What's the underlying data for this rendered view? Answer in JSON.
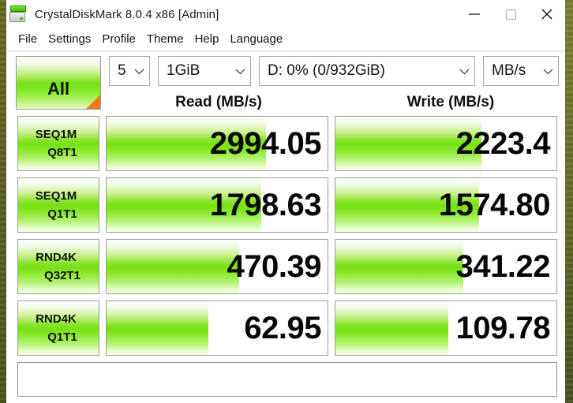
{
  "window": {
    "title": "CrystalDiskMark 8.0.4 x86 [Admin]",
    "controls": {
      "minimize": "minimize-icon",
      "maximize": "maximize-icon",
      "close": "close-icon"
    }
  },
  "menu": {
    "items": [
      {
        "label": "File"
      },
      {
        "label": "Settings"
      },
      {
        "label": "Profile"
      },
      {
        "label": "Theme"
      },
      {
        "label": "Help"
      },
      {
        "label": "Language"
      }
    ]
  },
  "toolbar": {
    "all_button": "All",
    "test_count": "5",
    "test_size": "1GiB",
    "target_drive": "D:  0% (0/932GiB)",
    "unit": "MB/s"
  },
  "headers": {
    "read": "Read (MB/s)",
    "write": "Write (MB/s)"
  },
  "colors": {
    "accent_green": "#77e113",
    "corner_orange": "#f07b14",
    "text": "#0f0f0f",
    "border": "#9c9c9c"
  },
  "chart_data": {
    "type": "bar",
    "title": "CrystalDiskMark 8.0.4 benchmark results",
    "categories": [
      "SEQ1M Q8T1",
      "SEQ1M Q1T1",
      "RND4K Q32T1",
      "RND4K Q1T1"
    ],
    "unit": "MB/s",
    "series": [
      {
        "name": "Read (MB/s)",
        "values": [
          2994.05,
          1798.63,
          470.39,
          62.95
        ]
      },
      {
        "name": "Write (MB/s)",
        "values": [
          2223.4,
          1574.8,
          341.22,
          109.78
        ]
      }
    ],
    "legend": "none",
    "grid": false
  },
  "rows": [
    {
      "label_line1": "SEQ1M",
      "label_line2": "Q8T1",
      "read": {
        "value": "2994.05",
        "fill_pct": 72
      },
      "write": {
        "value": "2223.4",
        "fill_pct": 66
      }
    },
    {
      "label_line1": "SEQ1M",
      "label_line2": "Q1T1",
      "read": {
        "value": "1798.63",
        "fill_pct": 70
      },
      "write": {
        "value": "1574.80",
        "fill_pct": 65
      }
    },
    {
      "label_line1": "RND4K",
      "label_line2": "Q32T1",
      "read": {
        "value": "470.39",
        "fill_pct": 60
      },
      "write": {
        "value": "341.22",
        "fill_pct": 58
      }
    },
    {
      "label_line1": "RND4K",
      "label_line2": "Q1T1",
      "read": {
        "value": "62.95",
        "fill_pct": 46
      },
      "write": {
        "value": "109.78",
        "fill_pct": 51
      }
    }
  ],
  "comment": {
    "value": "",
    "placeholder": ""
  }
}
